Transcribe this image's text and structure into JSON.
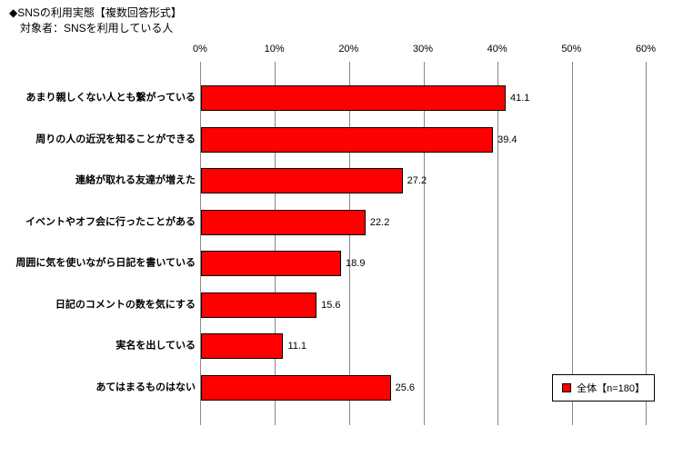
{
  "title": "◆SNSの利用実態【複数回答形式】",
  "subtitle": "対象者：SNSを利用している人",
  "legend_label": "全体【n=180】",
  "chart_data": {
    "type": "bar",
    "orientation": "horizontal",
    "xlabel": "",
    "ylabel": "",
    "xlim": [
      0,
      60
    ],
    "categories": [
      "あまり親しくない人とも繋がっている",
      "周りの人の近況を知ることができる",
      "連絡が取れる友達が増えた",
      "イベントやオフ会に行ったことがある",
      "周囲に気を使いながら日記を書いている",
      "日記のコメントの数を気にする",
      "実名を出している",
      "あてはまるものはない"
    ],
    "values": [
      41.1,
      39.4,
      27.2,
      22.2,
      18.9,
      15.6,
      11.1,
      25.6
    ],
    "ticks": [
      0,
      10,
      20,
      30,
      40,
      50,
      60
    ],
    "tick_labels": [
      "0%",
      "10%",
      "20%",
      "30%",
      "40%",
      "50%",
      "60%"
    ]
  }
}
